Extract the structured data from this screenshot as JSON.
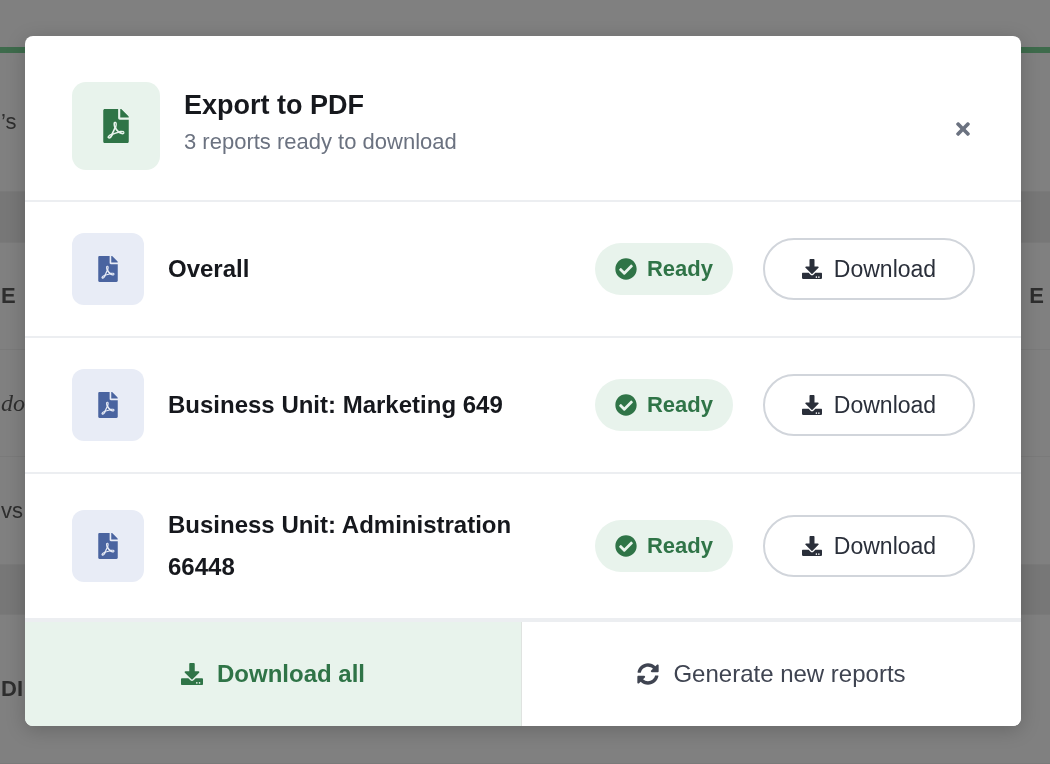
{
  "background": {
    "rows": [
      {
        "left": {
          "text": "’s",
          "kind": "plain"
        }
      },
      {
        "left": {
          "text": "E",
          "kind": "heading"
        },
        "right": {
          "text": "E",
          "kind": "heading"
        }
      },
      {
        "left": {
          "text": "do",
          "kind": "italic"
        }
      },
      {
        "left": {
          "text": "vs",
          "kind": "plain"
        }
      },
      {
        "left": {
          "text": "DI",
          "kind": "heading"
        }
      }
    ]
  },
  "dialog": {
    "title": "Export to PDF",
    "subtitle": "3 reports ready to download",
    "reports": [
      {
        "name": "Overall",
        "status": {
          "label": "Ready",
          "kind": "ready"
        },
        "action": "Download"
      },
      {
        "name": "Business Unit: Marketing 649",
        "status": {
          "label": "Ready",
          "kind": "ready"
        },
        "action": "Download"
      },
      {
        "name": "Business Unit: Administration 66448",
        "status": {
          "label": "Ready",
          "kind": "ready"
        },
        "action": "Download"
      }
    ],
    "footer": [
      {
        "label": "Download all",
        "kind": "primary"
      },
      {
        "label": "Generate new reports",
        "kind": "secondary"
      }
    ]
  }
}
